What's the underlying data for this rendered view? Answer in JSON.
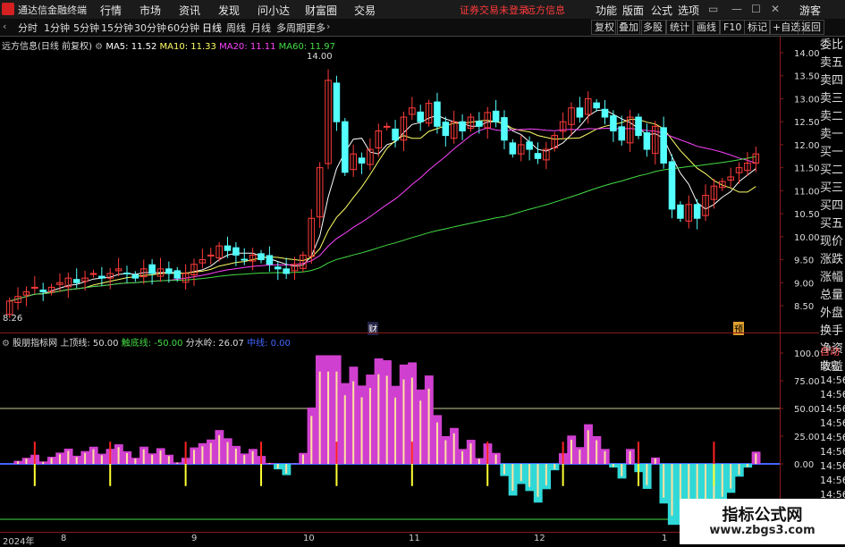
{
  "titlebar": {
    "app_name": "通达信金融终端",
    "menus": [
      "行情",
      "市场",
      "资讯",
      "发现",
      "问小达",
      "财富圈",
      "交易"
    ],
    "warning": "证券交易未登录",
    "stock_name": "远方信息",
    "right_menus": [
      "功能",
      "版面",
      "公式",
      "选项"
    ],
    "guest": "游客"
  },
  "toolbar": {
    "periods": [
      "分时",
      "1分钟",
      "5分钟",
      "15分钟",
      "30分钟",
      "60分钟",
      "日线",
      "周线",
      "月线",
      "多周期",
      "更多"
    ],
    "active_period": "日线",
    "right_buttons": [
      "复权",
      "叠加",
      "多股",
      "统计",
      "画线",
      "F10",
      "标记",
      "+自选",
      "返回"
    ]
  },
  "main_chart": {
    "title": "远方信息(日线 前复权)",
    "ma": [
      {
        "label": "MA5: 11.52",
        "color": "#ffffff"
      },
      {
        "label": "MA10: 11.33",
        "color": "#ffff66"
      },
      {
        "label": "MA20: 11.11",
        "color": "#ff44ff"
      },
      {
        "label": "MA60: 11.97",
        "color": "#44dd44"
      }
    ],
    "high_label": "14.00",
    "low_label": "8.26",
    "marker_cai": "财",
    "marker_yu": "预",
    "yaxis_ticks": [
      "14.00",
      "13.50",
      "13.00",
      "12.50",
      "12.00",
      "11.50",
      "11.00",
      "10.50",
      "10.00",
      "9.50",
      "9.00",
      "8.50"
    ]
  },
  "indicator": {
    "name": "股朋指标网",
    "upper_label": "上顶线: 50.00",
    "lower_label": "触底线: -50.00",
    "divider_label": "分水岭: 26.07",
    "mid_label": "中线: 0.00",
    "yaxis_ticks": [
      "100.0",
      "75.00",
      "50.00",
      "25.00",
      "0.00"
    ]
  },
  "side_panel": [
    "委比",
    "卖五",
    "卖四",
    "卖三",
    "卖二",
    "卖一",
    "买一",
    "买二",
    "买三",
    "买四",
    "买五",
    "现价",
    "涨跌",
    "涨幅",
    "总量",
    "外盘",
    "换手",
    "净资",
    "收益"
  ],
  "side_panel2": [
    "自动",
    "交易",
    "14:56",
    "14:56",
    "14:56",
    "14:56",
    "14:56",
    "14:56",
    "14:56",
    "14:56",
    "14:56"
  ],
  "xaxis": [
    "2024年",
    "8",
    "9",
    "10",
    "11",
    "12",
    "1"
  ],
  "watermark": {
    "title": "指标公式网",
    "url": "www.zbgs3.com"
  },
  "chart_data": {
    "type": "candlestick",
    "close": [
      8.6,
      8.7,
      8.8,
      8.9,
      8.8,
      8.9,
      9.0,
      9.1,
      9.0,
      9.1,
      9.2,
      9.1,
      9.2,
      9.3,
      9.2,
      9.1,
      9.3,
      9.2,
      9.3,
      9.2,
      9.1,
      9.2,
      9.4,
      9.5,
      9.6,
      9.8,
      9.7,
      9.6,
      9.5,
      9.6,
      9.5,
      9.4,
      9.3,
      9.2,
      9.4,
      9.6,
      10.4,
      11.5,
      13.4,
      12.5,
      11.4,
      11.8,
      11.6,
      11.9,
      12.3,
      12.4,
      12.1,
      12.6,
      12.8,
      12.5,
      12.9,
      12.4,
      12.2,
      12.5,
      12.3,
      12.6,
      12.4,
      12.7,
      12.5,
      12.1,
      11.8,
      12.0,
      11.9,
      11.7,
      11.9,
      12.2,
      12.5,
      12.8,
      12.6,
      13.0,
      12.8,
      12.6,
      12.3,
      12.1,
      12.6,
      12.2,
      11.9,
      12.4,
      11.6,
      10.6,
      10.4,
      10.7,
      10.4,
      10.9,
      11.1,
      11.2,
      11.3,
      11.5,
      11.6,
      11.8
    ]
  }
}
